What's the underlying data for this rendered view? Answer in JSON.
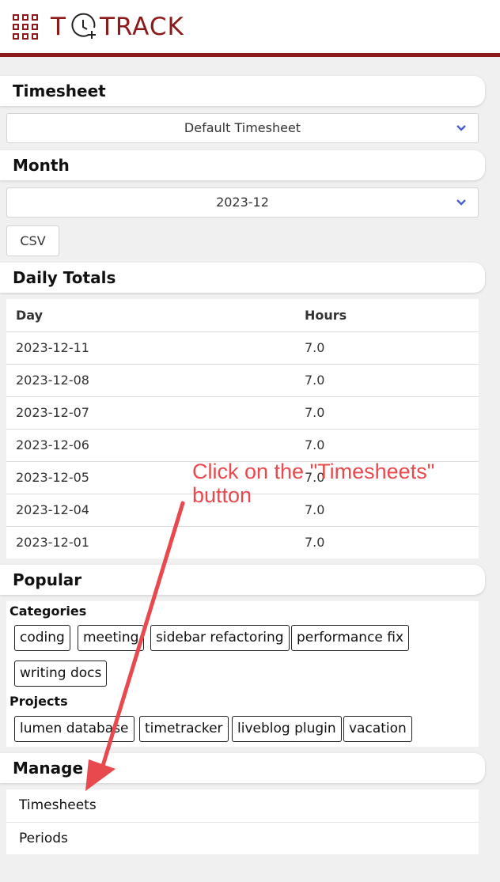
{
  "header": {
    "logo_left": "T",
    "logo_right": "TRACK",
    "brand_color": "#8b1a1a"
  },
  "timesheet": {
    "heading": "Timesheet",
    "selected": "Default Timesheet"
  },
  "month": {
    "heading": "Month",
    "selected": "2023-12",
    "csv_label": "CSV"
  },
  "daily_totals": {
    "heading": "Daily Totals",
    "columns": [
      "Day",
      "Hours"
    ],
    "rows": [
      [
        "2023-12-11",
        "7.0"
      ],
      [
        "2023-12-08",
        "7.0"
      ],
      [
        "2023-12-07",
        "7.0"
      ],
      [
        "2023-12-06",
        "7.0"
      ],
      [
        "2023-12-05",
        "7.0"
      ],
      [
        "2023-12-04",
        "7.0"
      ],
      [
        "2023-12-01",
        "7.0"
      ]
    ]
  },
  "popular": {
    "heading": "Popular",
    "categories_label": "Categories",
    "categories": [
      "coding",
      "meeting",
      "sidebar refactoring",
      "performance fix",
      "writing docs"
    ],
    "projects_label": "Projects",
    "projects": [
      "lumen database",
      "timetracker",
      "liveblog plugin",
      "vacation"
    ]
  },
  "manage": {
    "heading": "Manage",
    "items": [
      "Timesheets",
      "Periods"
    ]
  },
  "annotation": {
    "text": "Click on the \"Timesheets\" button",
    "color": "#e8494e"
  },
  "icons": {
    "apps": "grid-apps-icon",
    "chevron": "chevron-down-icon",
    "logo": "clock-plus-icon"
  }
}
